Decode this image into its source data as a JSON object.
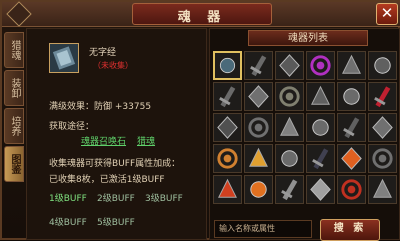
{
  "window": {
    "title": "魂 器",
    "close_glyph": "✕"
  },
  "tabs": [
    {
      "label": "猎魂",
      "active": false
    },
    {
      "label": "装卸",
      "active": false
    },
    {
      "label": "培养",
      "active": false
    },
    {
      "label": "图鉴",
      "active": true
    }
  ],
  "detail": {
    "item_name": "无字经",
    "item_status": "（未收集）",
    "full_level_effect_label": "满级效果：",
    "full_level_effect_value": "防御 +33755",
    "obtain_label": "获取途径：",
    "obtain_links": [
      "魂器召唤石",
      "猎魂"
    ],
    "buff_intro": "收集魂器可获得BUFF属性加成：",
    "collected_text": "已收集8枚，已激活1级BUFF",
    "buff_levels": [
      "1级BUFF",
      "2级BUFF",
      "3级BUFF",
      "4级BUFF",
      "5级BUFF"
    ],
    "active_buff_color": "#7fe07f"
  },
  "list": {
    "header": "魂器列表",
    "items": [
      {
        "icon": "scroll-icon",
        "selected": true,
        "color": "#4a6a7a"
      },
      {
        "icon": "sword-icon",
        "selected": false,
        "color": "#6a6a6a"
      },
      {
        "icon": "scythe-icon",
        "selected": false,
        "color": "#5a5a5a"
      },
      {
        "icon": "orb-icon",
        "selected": false,
        "color": "#b030c0"
      },
      {
        "icon": "dragon-orb-icon",
        "selected": false,
        "color": "#707070"
      },
      {
        "icon": "bead-icon",
        "selected": false,
        "color": "#606060"
      },
      {
        "icon": "hammer-icon",
        "selected": false,
        "color": "#6a6a6a"
      },
      {
        "icon": "fist-icon",
        "selected": false,
        "color": "#707070"
      },
      {
        "icon": "beast-head-icon",
        "selected": false,
        "color": "#808070"
      },
      {
        "icon": "orb-ring-icon",
        "selected": false,
        "color": "#606060"
      },
      {
        "icon": "pendant-icon",
        "selected": false,
        "color": "#6a6a6a"
      },
      {
        "icon": "crystal-gem-icon",
        "selected": false,
        "color": "#c02030"
      },
      {
        "icon": "shield-disc-icon",
        "selected": false,
        "color": "#505050"
      },
      {
        "icon": "blade-icon",
        "selected": false,
        "color": "#707070"
      },
      {
        "icon": "chain-icon",
        "selected": false,
        "color": "#808080"
      },
      {
        "icon": "talisman-icon",
        "selected": false,
        "color": "#6a6a6a"
      },
      {
        "icon": "lantern-icon",
        "selected": false,
        "color": "#606060"
      },
      {
        "icon": "spike-icon",
        "selected": false,
        "color": "#707070"
      },
      {
        "icon": "staff-icon",
        "selected": false,
        "color": "#d08030"
      },
      {
        "icon": "golden-skull-icon",
        "selected": false,
        "color": "#e0a030"
      },
      {
        "icon": "claw-icon",
        "selected": false,
        "color": "#6a6a6a"
      },
      {
        "icon": "dark-orb-icon",
        "selected": false,
        "color": "#404050"
      },
      {
        "icon": "phoenix-icon",
        "selected": false,
        "color": "#e06020"
      },
      {
        "icon": "mace-icon",
        "selected": false,
        "color": "#707070"
      },
      {
        "icon": "fire-staff-icon",
        "selected": false,
        "color": "#d04020"
      },
      {
        "icon": "flame-icon",
        "selected": false,
        "color": "#e07020"
      },
      {
        "icon": "orb-icon",
        "selected": false,
        "color": "#909090"
      },
      {
        "icon": "fan-icon",
        "selected": false,
        "color": "#a0a0a0"
      },
      {
        "icon": "dragon-icon",
        "selected": false,
        "color": "#c03020"
      },
      {
        "icon": "shell-icon",
        "selected": false,
        "color": "#808080"
      }
    ],
    "search_placeholder": "输入名称或属性",
    "search_button": "搜 索"
  }
}
